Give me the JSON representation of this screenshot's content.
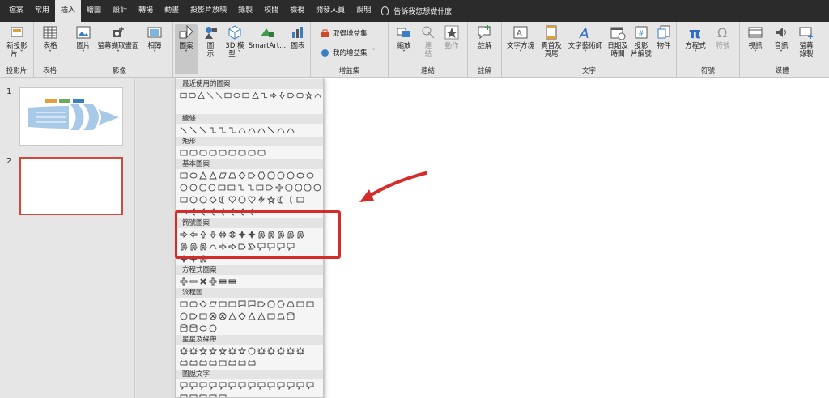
{
  "tabs": [
    "檔案",
    "常用",
    "插入",
    "繪圖",
    "設計",
    "轉場",
    "動畫",
    "投影片放映",
    "錄製",
    "校閱",
    "檢視",
    "開發人員",
    "說明"
  ],
  "active_tab_index": 2,
  "tell_me": "告訴我您想做什麼",
  "groups": {
    "slides": {
      "label": "投影片",
      "new_slide": [
        "新投影",
        "片 ˇ"
      ]
    },
    "tables": {
      "label": "表格",
      "table": [
        "表格",
        "ˇ"
      ]
    },
    "images": {
      "label": "影像",
      "pictures": [
        "圖片",
        "ˇ"
      ],
      "screenshot": [
        "螢幕擷取畫面",
        "ˇ"
      ],
      "album": [
        "相簿",
        "ˇ"
      ]
    },
    "illustrations": {
      "shapes": [
        "圖案",
        "ˇ"
      ],
      "icons": [
        "圖",
        "示"
      ],
      "model3d": [
        "3D 模",
        "型 ˇ"
      ],
      "smartart": "SmartArt...",
      "chart": "圖表"
    },
    "addins": {
      "label": "增益集",
      "get": "取得增益集",
      "my": "我的增益集"
    },
    "links": {
      "label": "連結",
      "zoom": [
        "縮放",
        "ˇ"
      ],
      "link": [
        "連",
        "結"
      ],
      "action": "動作"
    },
    "comments": {
      "label": "註解",
      "comment": "註解"
    },
    "text": {
      "label": "文字",
      "textbox": [
        "文字方塊",
        "ˇ"
      ],
      "header": [
        "頁首及",
        "頁尾"
      ],
      "wordart": [
        "文字藝術師",
        "ˇ"
      ],
      "datetime": [
        "日期及",
        "時間"
      ],
      "slidenum": [
        "投影",
        "片編號"
      ],
      "object": "物件"
    },
    "symbols": {
      "label": "符號",
      "equation": [
        "方程式",
        "ˇ"
      ],
      "symbol": "符號"
    },
    "media": {
      "label": "媒體",
      "video": [
        "視訊",
        "ˇ"
      ],
      "audio": [
        "音訊",
        "ˇ"
      ],
      "record": [
        "螢幕",
        "錄製"
      ]
    }
  },
  "slide_numbers": [
    "1",
    "2"
  ],
  "shape_sections": [
    "最近使用的圖案",
    "線條",
    "矩形",
    "基本圖案",
    "箭號圖案",
    "方程式圖案",
    "流程圖",
    "星星及綵帶",
    "圖說文字"
  ],
  "colors": {
    "accent_red": "#d62b2b",
    "tab_bar": "#2b2b2b",
    "selected_slide_border": "#d0493b",
    "fish_blue": "#a9c9e8"
  }
}
